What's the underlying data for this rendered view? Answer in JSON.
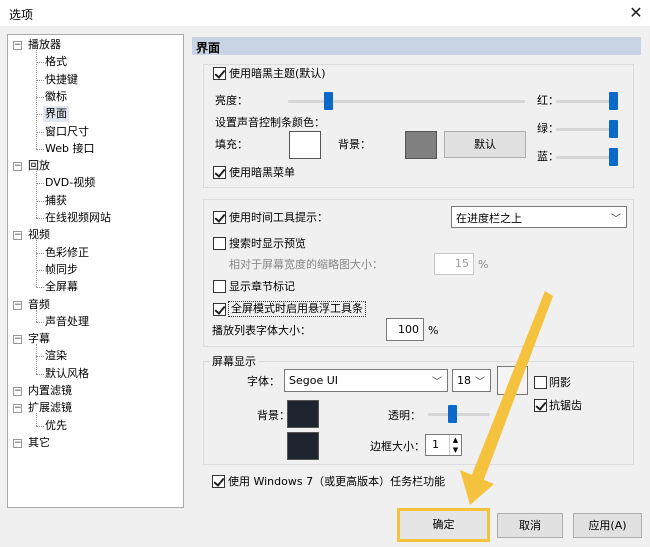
{
  "window": {
    "title": "选项",
    "close_glyph": "✕"
  },
  "tree": {
    "expanders": {
      "minus": "−"
    },
    "items": [
      {
        "label": "播放器",
        "level": 0
      },
      {
        "label": "格式",
        "level": 1
      },
      {
        "label": "快捷键",
        "level": 1
      },
      {
        "label": "徽标",
        "level": 1
      },
      {
        "label": "界面",
        "level": 1,
        "selected": true
      },
      {
        "label": "窗口尺寸",
        "level": 1
      },
      {
        "label": "Web 接口",
        "level": 1
      },
      {
        "label": "回放",
        "level": 0
      },
      {
        "label": "DVD-视频",
        "level": 1
      },
      {
        "label": "捕获",
        "level": 1
      },
      {
        "label": "在线视频网站",
        "level": 1
      },
      {
        "label": "视频",
        "level": 0
      },
      {
        "label": "色彩修正",
        "level": 1
      },
      {
        "label": "帧同步",
        "level": 1
      },
      {
        "label": "全屏幕",
        "level": 1
      },
      {
        "label": "音频",
        "level": 0
      },
      {
        "label": "声音处理",
        "level": 1
      },
      {
        "label": "字幕",
        "level": 0
      },
      {
        "label": "渲染",
        "level": 1
      },
      {
        "label": "默认风格",
        "level": 1
      },
      {
        "label": "内置滤镜",
        "level": 0
      },
      {
        "label": "扩展滤镜",
        "level": 0
      },
      {
        "label": "优先",
        "level": 1
      },
      {
        "label": "其它",
        "level": 0
      }
    ]
  },
  "page": {
    "title": "界面",
    "theme": {
      "dark_theme_label": "使用暗黑主题(默认)",
      "dark_theme_checked": true,
      "brightness_label": "亮度：",
      "brightness_value": 0.15,
      "red_label": "红：",
      "red_value": 1.0,
      "green_label": "绿：",
      "green_value": 1.0,
      "blue_label": "蓝：",
      "blue_value": 1.0,
      "seekbar_color_label": "设置声音控制条颜色：",
      "fill_label": "填充：",
      "fill_color": "#ffffff",
      "background_label": "背景：",
      "background_color": "#808080",
      "default_button": "默认",
      "dark_menu_label": "使用暗黑菜单",
      "dark_menu_checked": true
    },
    "tooltips": {
      "time_tooltip_label": "使用时间工具提示：",
      "time_tooltip_checked": true,
      "tooltip_position": "在进度栏之上",
      "preview_label": "搜索时显示预览",
      "preview_checked": false,
      "thumb_size_label": "相对于屏幕宽度的缩略图大小：",
      "thumb_size_value": "15",
      "thumb_size_unit": "%",
      "chapter_marks_label": "显示章节标记",
      "chapter_marks_checked": false,
      "floating_toolbar_label": "全屏模式时启用悬浮工具条",
      "floating_toolbar_checked": true,
      "playlist_font_label": "播放列表字体大小：",
      "playlist_font_value": "100",
      "playlist_font_unit": "%"
    },
    "osd": {
      "group_label": "屏幕显示",
      "font_label": "字体：",
      "font_value": "Segoe UI",
      "font_size_value": "18",
      "font_color": "#f4f4f4",
      "shadow_label": "阴影",
      "shadow_checked": false,
      "antialias_label": "抗锯齿",
      "antialias_checked": true,
      "background_label": "背景：",
      "background_color": "#1e2530",
      "transparency_label": "透明：",
      "transparency_value": 0.37,
      "border_color": "#1e2530",
      "border_label": "边框大小：",
      "border_value": "1"
    },
    "win7_label": "使用 Windows 7（或更高版本）任务栏功能",
    "win7_checked": true
  },
  "buttons": {
    "ok": "确定",
    "cancel": "取消",
    "apply": "应用(A)"
  },
  "colors": {
    "accent": "#0a69c9",
    "highlight": "#f5c23e",
    "header": "#c8d4e3"
  }
}
